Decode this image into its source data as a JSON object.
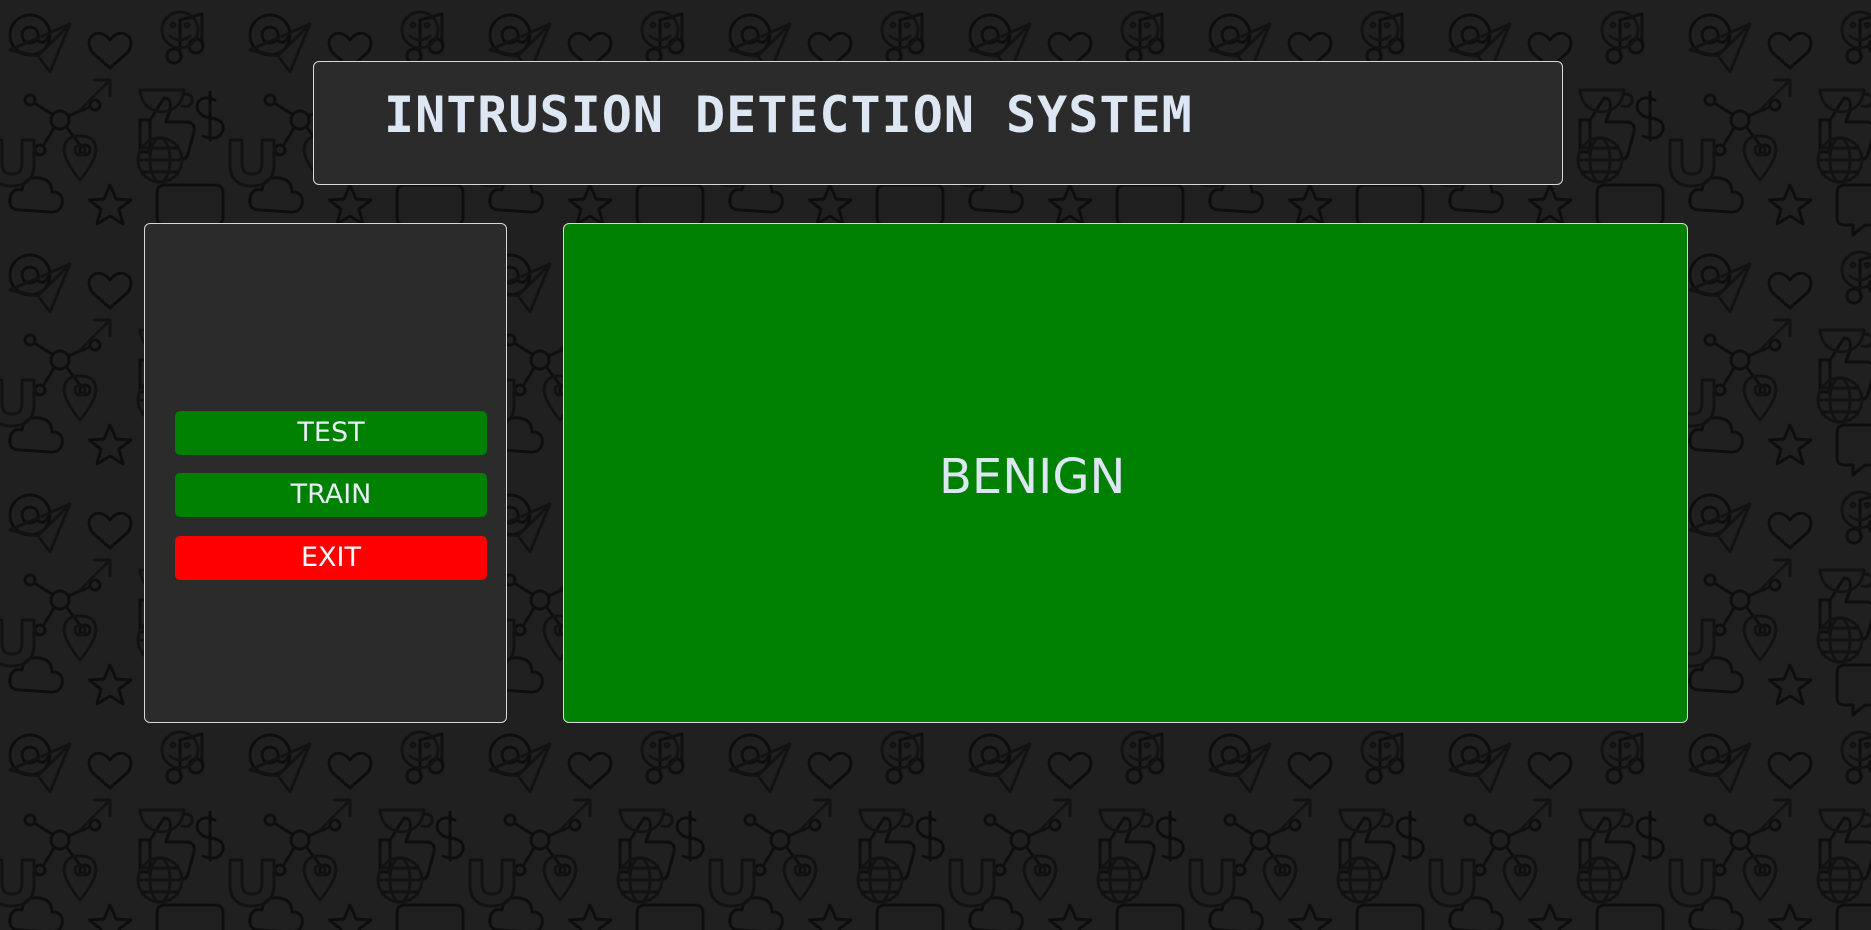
{
  "app": {
    "title": "INTRUSION DETECTION SYSTEM"
  },
  "sidebar": {
    "buttons": {
      "test_label": "TEST",
      "train_label": "TRAIN",
      "exit_label": "EXIT"
    }
  },
  "result": {
    "label": "BENIGN"
  },
  "colors": {
    "background": "#1f1f1f",
    "panel": "#2b2b2b",
    "primary_button": "#008000",
    "exit_button": "#ff0000",
    "result_panel": "#008000",
    "text": "#dde6f3"
  },
  "background_doodle_icons": [
    "at-sign-icon",
    "cloud-icon",
    "thumbs-up-icon",
    "dollar-icon",
    "heart-icon",
    "music-note-icon",
    "globe-icon",
    "network-icon",
    "pencil-icon",
    "megaphone-icon",
    "magnet-icon",
    "speech-bubble-icon",
    "star-icon",
    "paper-plane-icon",
    "coffee-cup-icon",
    "location-pin-icon",
    "phone-icon",
    "smiley-icon",
    "key-icon",
    "arrow-icon"
  ]
}
